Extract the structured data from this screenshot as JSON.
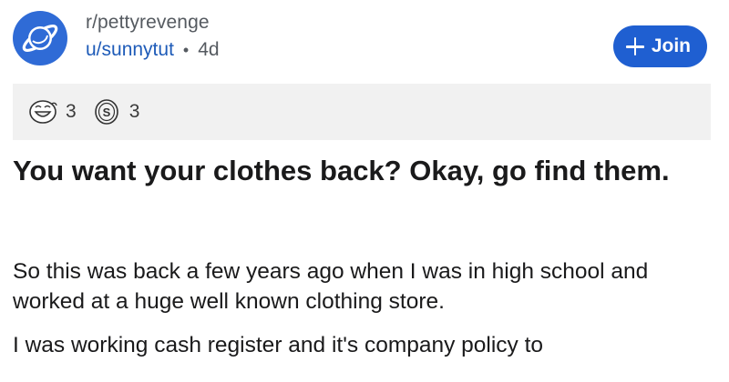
{
  "post": {
    "subreddit": "r/pettyrevenge",
    "username": "u/sunnytut",
    "separator": "•",
    "age": "4d",
    "join_label": "Join",
    "awards": [
      {
        "icon": "laughing-face-award",
        "count": "3"
      },
      {
        "icon": "dollar-coin-award",
        "count": "3"
      }
    ],
    "title": "You want your clothes back? Okay, go find them.",
    "paragraphs": [
      "So this was back a few years ago when I was in high school and worked at a huge well known clothing store.",
      "I was working cash register and it's company policy to"
    ]
  },
  "colors": {
    "subreddit_icon": "#2f6bd6",
    "join_button": "#1f5fd1",
    "username": "#1e5bb8",
    "award_bar": "#f1f1f1"
  }
}
